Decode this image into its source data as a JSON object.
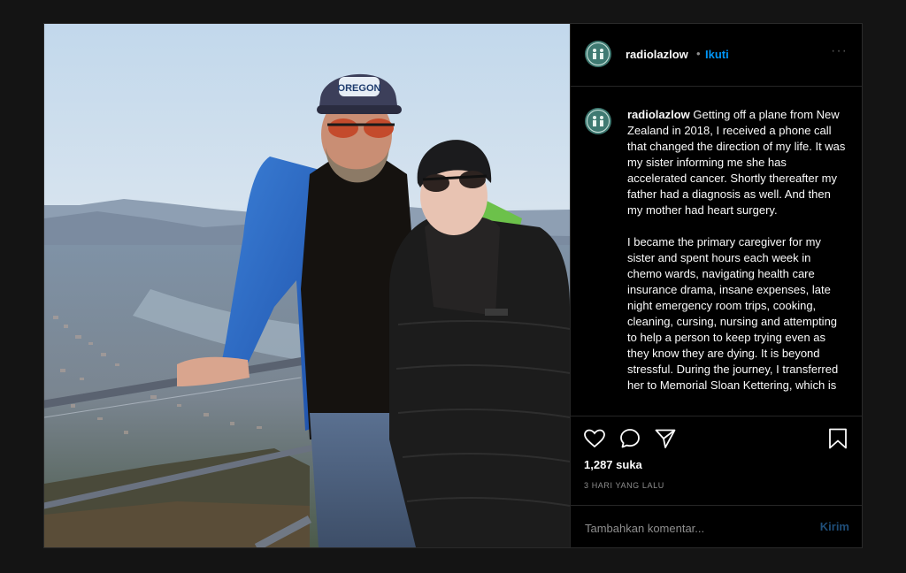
{
  "post": {
    "username": "radiolazlow",
    "follow_label": "Ikuti",
    "separator": "•",
    "more_label": "···",
    "caption_username": "radiolazlow",
    "caption_text": " Getting off a plane from New Zealand in 2018, I received a phone call that changed the direction of my life. It was my sister informing me she has accelerated cancer. Shortly thereafter my father had a diagnosis as well. And then my mother had heart surgery.\n\nI became the primary caregiver for my sister and spent hours each week in chemo wards, navigating health care insurance drama, insane expenses, late night emergency room trips, cooking, cleaning, cursing, nursing and attempting to help a person to keep trying even as they know they are dying. It is beyond stressful. During the journey, I transferred her to Memorial Sloan Kettering, which is",
    "likes": "1,287 suka",
    "time": "3 HARI YANG LALU",
    "comment_placeholder": "Tambahkan komentar...",
    "post_label": "Kirim"
  },
  "photo": {
    "cap_text": "OREGON"
  },
  "icons": [
    "heart-icon",
    "comment-icon",
    "share-icon",
    "bookmark-icon",
    "avatar"
  ],
  "colors": {
    "accent": "#0095f6",
    "background": "#000000",
    "page": "#141414"
  }
}
